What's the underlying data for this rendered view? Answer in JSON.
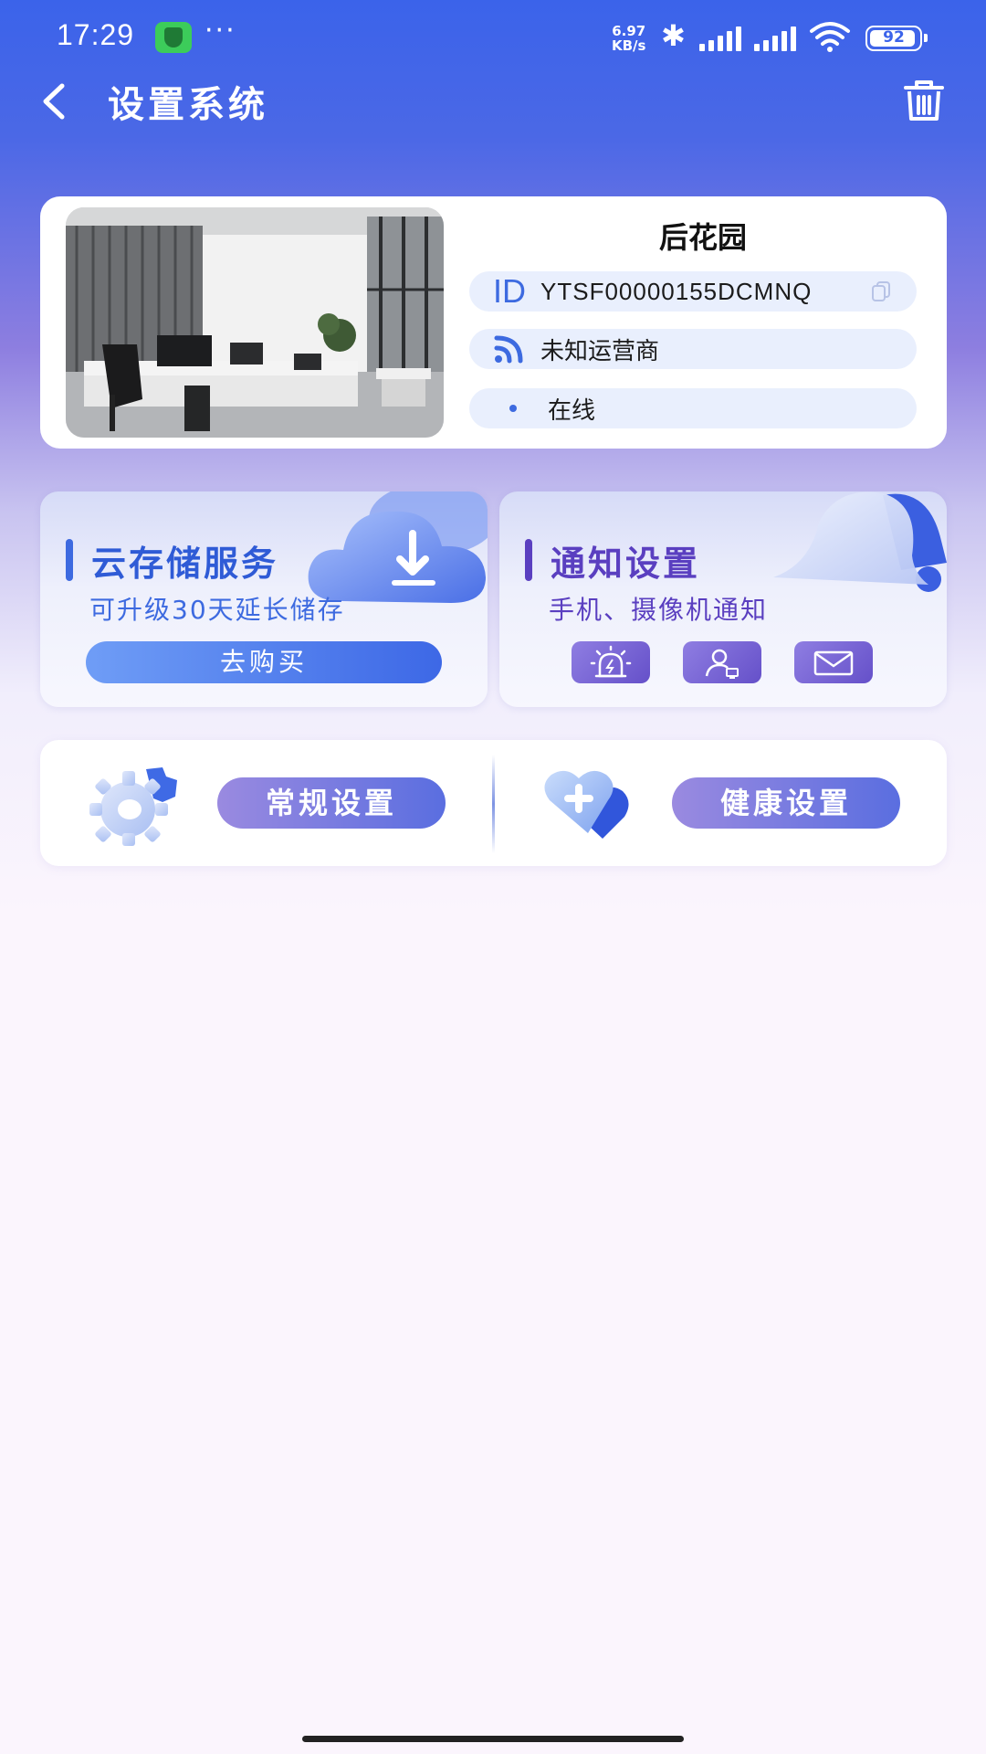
{
  "status_bar": {
    "time": "17:29",
    "more": "···",
    "net_speed_value": "6.97",
    "net_speed_unit": "KB/s",
    "battery": "92",
    "icons": [
      "app-notification-icon",
      "bluetooth-icon",
      "signal-icon",
      "signal-icon",
      "wifi-icon",
      "battery-icon"
    ]
  },
  "header": {
    "title": "设置系统",
    "back_icon": "chevron-left-icon",
    "delete_icon": "trash-icon"
  },
  "device": {
    "name": "后花园",
    "id_mark": "ID",
    "id": "YTSF00000155DCMNQ",
    "carrier": "未知运营商",
    "status": "在线",
    "status_color": "#3d6ae0"
  },
  "cloud_storage": {
    "title": "云存储服务",
    "subtitle": "可升级30天延长储存",
    "button": "去购买",
    "accent": "#3d6ae0"
  },
  "notification": {
    "title": "通知设置",
    "subtitle": "手机、摄像机通知",
    "accent": "#5a3fc0",
    "buttons": [
      "alarm-light-icon",
      "user-device-icon",
      "mail-icon"
    ]
  },
  "settings": {
    "general": "常规设置",
    "health": "健康设置"
  },
  "colors": {
    "primary": "#3b63ea",
    "purple": "#6550c9"
  }
}
